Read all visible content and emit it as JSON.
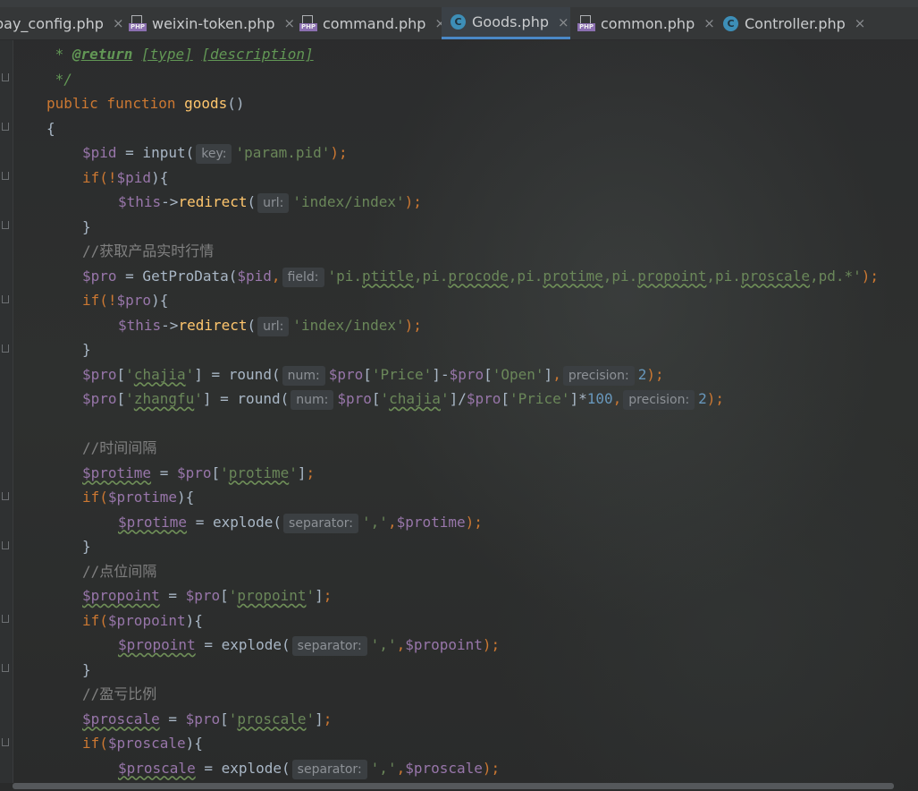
{
  "tabs": [
    {
      "label": "pay_config.php",
      "icon": "php-file-icon",
      "close": "×",
      "active": false
    },
    {
      "label": "weixin-token.php",
      "icon": "php-file-icon",
      "close": "×",
      "active": false
    },
    {
      "label": "command.php",
      "icon": "php-file-icon",
      "close": "×",
      "active": false
    },
    {
      "label": "Goods.php",
      "icon": "class-file-icon",
      "close": "×",
      "active": true
    },
    {
      "label": "common.php",
      "icon": "php-file-icon",
      "close": "×",
      "active": false
    },
    {
      "label": "Controller.php",
      "icon": "class-file-icon",
      "close": "×",
      "active": false
    }
  ],
  "editor": {
    "colors": {
      "keyword": "#cc7832",
      "function": "#ffc66d",
      "variable": "#9876aa",
      "string": "#6a8759",
      "number": "#6897bb",
      "comment": "#808080",
      "doc": "#629755",
      "text": "#a9b7c6"
    },
    "hints": {
      "key": "key:",
      "url": "url:",
      "field": "field:",
      "num": "num:",
      "precision": "precision:",
      "separator": "separator:"
    },
    "lines": {
      "l1_star": " * ",
      "l1_tag": "@return",
      "l1_type": "[type]",
      "l1_desc": "[description]",
      "l2": " */",
      "l3_kw": "public function ",
      "l3_fn": "goods",
      "l3_rest": "()",
      "l4": "{",
      "pid_var": "$pid",
      "pid_eq": " = input(",
      "pid_str": "'param.pid'",
      "end_paren": ");",
      "if_pid_a": "if(!",
      "if_pid_b": "){",
      "this": "$this",
      "arrow": "->",
      "redirect": "redirect",
      "open_paren": "(",
      "index_str": "'index/index'",
      "close_brace": "}",
      "cm_price": "//获取产品实时行情",
      "pro_var": "$pro",
      "pro_eq": " = GetProData(",
      "comma": ",",
      "field_str_a": "'pi.",
      "ptitle": "ptitle",
      "c1": ",pi.",
      "procode": "procode",
      "c2": ",pi.",
      "protime_f": "protime",
      "c3": ",pi.",
      "propoint_f": "propoint",
      "c4": ",pi.",
      "proscale_f": "proscale",
      "field_str_b": ",pd.*'",
      "if_pro_a": "if(!",
      "if_pro_b": "){",
      "bracket_open": "[",
      "bracket_close": "]",
      "q": "'",
      "chajia": "chajia",
      "zhangfu": "zhangfu",
      "round_eq": "] = round(",
      "price_str": "'Price'",
      "open_str": "'Open'",
      "minus": "-",
      "two": "2",
      "hundred": "100",
      "mul": "*",
      "div": "]/",
      "cm_time": "//时间间隔",
      "protime_var": "$protime",
      "eq_sp": " = ",
      "protime_key": "protime",
      "if_a": "if(",
      "if_b": "){",
      "explode": " = explode(",
      "sep_str": "','",
      "cm_point": "//点位间隔",
      "propoint_var": "$propoint",
      "propoint_key": "propoint",
      "cm_scale": "//盈亏比例",
      "proscale_var": "$proscale",
      "proscale_key": "proscale"
    }
  }
}
